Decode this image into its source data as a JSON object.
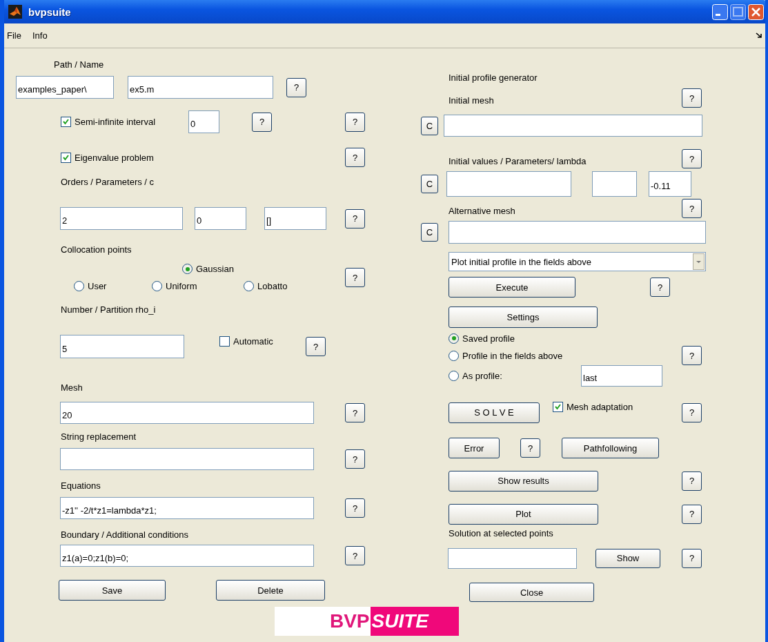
{
  "window": {
    "title": "bvpsuite"
  },
  "menu": [
    "File",
    "Info"
  ],
  "left": {
    "path": {
      "label": "Path / Name",
      "folder": "examples_paper\\",
      "file": "ex5.m",
      "help": "?"
    },
    "semi_infinite": {
      "label": "Semi-infinite interval",
      "checked": true,
      "value": "0",
      "help": "?",
      "help_2": "?"
    },
    "eigenvalue": {
      "label": "Eigenvalue problem",
      "checked": true,
      "help": "?"
    },
    "orders": {
      "label": "Orders / Parameters / c",
      "values": [
        "2",
        "0",
        "[]"
      ],
      "help": "?"
    },
    "collocation": {
      "label": "Collocation points",
      "options": [
        {
          "label": "Gaussian",
          "selected": true
        },
        {
          "label": "User",
          "selected": false
        },
        {
          "label": "Uniform",
          "selected": false
        },
        {
          "label": "Lobatto",
          "selected": false
        }
      ],
      "help": "?"
    },
    "number": {
      "label": "Number / Partition rho_i",
      "value": "5",
      "automatic": {
        "label": "Automatic",
        "checked": false
      },
      "help": "?"
    },
    "mesh": {
      "label": "Mesh",
      "value": "20",
      "help": "?"
    },
    "string_replacement": {
      "label": "String replacement",
      "help": "?"
    },
    "equations": {
      "label": "Equations",
      "value": "-z1'' -2/t*z1=lambda*z1;",
      "help": "?"
    },
    "boundary": {
      "label": "Boundary / Additional conditions",
      "value": "z1(a)=0;z1(b)=0;",
      "help": "?"
    },
    "buttons": [
      "Save",
      "Delete"
    ]
  },
  "right": {
    "title": "Initial profile generator",
    "initial_mesh": {
      "label": "Initial mesh",
      "clear": "C",
      "help": "?"
    },
    "initial_values": {
      "label": "Initial values / Parameters/ lambda",
      "clear": "C",
      "lambda": "-0.11",
      "help": "?"
    },
    "alternative_mesh": {
      "label": "Alternative mesh",
      "clear": "C",
      "help": "?"
    },
    "plot_mode": {
      "value": "Plot initial profile in the fields above"
    },
    "execute": {
      "label": "Execute",
      "help": "?"
    },
    "settings": "Settings",
    "profile_options": [
      {
        "label": "Saved profile",
        "selected": true
      },
      {
        "label": "Profile in the fields above",
        "selected": false
      },
      {
        "label": "As profile:",
        "selected": false
      }
    ],
    "profile_help": "?",
    "profile_name": "last",
    "solve": {
      "label": "S O L V E",
      "adaptation": {
        "label": "Mesh adaptation",
        "checked": true
      },
      "help": "?"
    },
    "error": {
      "label": "Error",
      "help": "?"
    },
    "pathfollowing": "Pathfollowing",
    "show_results": {
      "label": "Show results",
      "help": "?"
    },
    "plot": {
      "label": "Plot",
      "help": "?"
    },
    "solution": {
      "label": "Solution at selected points",
      "button": "Show",
      "help": "?"
    },
    "close": "Close"
  },
  "logo": {
    "prefix": "BVP",
    "suffix": "SUITE"
  }
}
